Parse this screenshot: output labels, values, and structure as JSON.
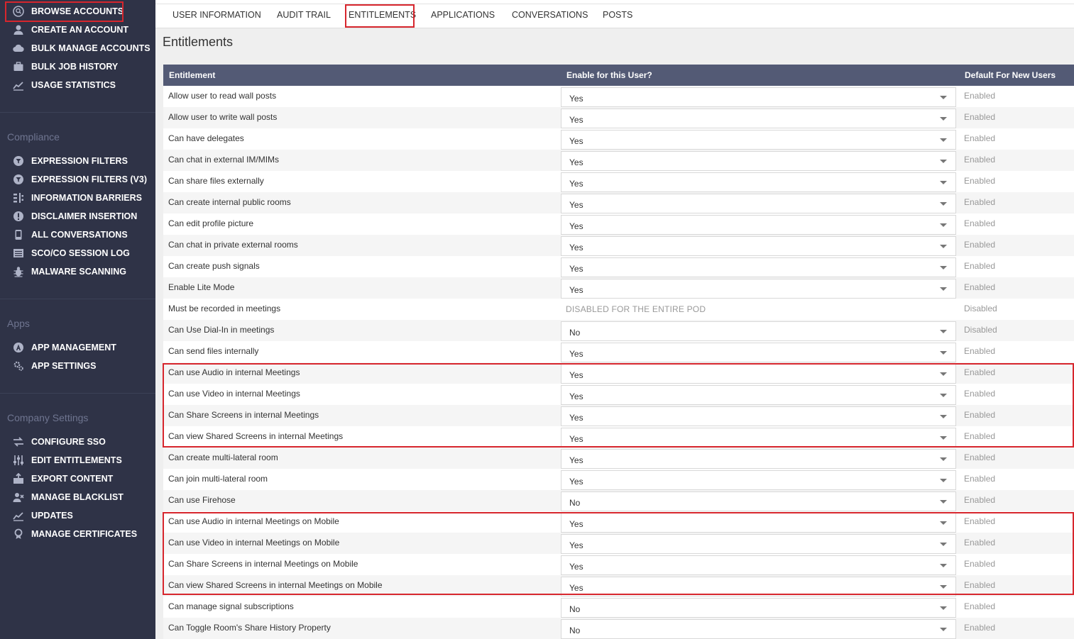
{
  "sidebar": {
    "top_items": [
      {
        "label": "BROWSE ACCOUNTS",
        "icon": "search-user-icon"
      },
      {
        "label": "CREATE AN ACCOUNT",
        "icon": "user-icon"
      },
      {
        "label": "BULK MANAGE ACCOUNTS",
        "icon": "cloud-icon"
      },
      {
        "label": "BULK JOB HISTORY",
        "icon": "briefcase-icon"
      },
      {
        "label": "USAGE STATISTICS",
        "icon": "chart-icon"
      }
    ],
    "compliance_title": "Compliance",
    "compliance_items": [
      {
        "label": "EXPRESSION FILTERS",
        "icon": "filter-icon"
      },
      {
        "label": "EXPRESSION FILTERS (V3)",
        "icon": "filter-icon"
      },
      {
        "label": "INFORMATION BARRIERS",
        "icon": "barrier-icon"
      },
      {
        "label": "DISCLAIMER INSERTION",
        "icon": "alert-icon"
      },
      {
        "label": "ALL CONVERSATIONS",
        "icon": "phone-icon"
      },
      {
        "label": "SCO/CO SESSION LOG",
        "icon": "log-icon"
      },
      {
        "label": "MALWARE SCANNING",
        "icon": "bug-icon"
      }
    ],
    "apps_title": "Apps",
    "apps_items": [
      {
        "label": "APP MANAGEMENT",
        "icon": "app-icon"
      },
      {
        "label": "APP SETTINGS",
        "icon": "gear-icon"
      }
    ],
    "company_title": "Company Settings",
    "company_items": [
      {
        "label": "CONFIGURE SSO",
        "icon": "swap-icon"
      },
      {
        "label": "EDIT ENTITLEMENTS",
        "icon": "sliders-icon"
      },
      {
        "label": "EXPORT CONTENT",
        "icon": "export-icon"
      },
      {
        "label": "MANAGE BLACKLIST",
        "icon": "person-block-icon"
      },
      {
        "label": "UPDATES",
        "icon": "chart-icon"
      },
      {
        "label": "MANAGE CERTIFICATES",
        "icon": "certificate-icon"
      }
    ]
  },
  "tabs": [
    {
      "label": "USER INFORMATION"
    },
    {
      "label": "AUDIT TRAIL"
    },
    {
      "label": "ENTITLEMENTS"
    },
    {
      "label": "APPLICATIONS"
    },
    {
      "label": "CONVERSATIONS"
    },
    {
      "label": "POSTS"
    }
  ],
  "page_title": "Entitlements",
  "table": {
    "headers": [
      "Entitlement",
      "Enable for this User?",
      "Default For New Users"
    ],
    "rows": [
      {
        "name": "Allow user to read wall posts",
        "value": "Yes",
        "default": "Enabled"
      },
      {
        "name": "Allow user to write wall posts",
        "value": "Yes",
        "default": "Enabled"
      },
      {
        "name": "Can have delegates",
        "value": "Yes",
        "default": "Enabled"
      },
      {
        "name": "Can chat in external IM/MIMs",
        "value": "Yes",
        "default": "Enabled"
      },
      {
        "name": "Can share files externally",
        "value": "Yes",
        "default": "Enabled"
      },
      {
        "name": "Can create internal public rooms",
        "value": "Yes",
        "default": "Enabled"
      },
      {
        "name": "Can edit profile picture",
        "value": "Yes",
        "default": "Enabled"
      },
      {
        "name": "Can chat in private external rooms",
        "value": "Yes",
        "default": "Enabled"
      },
      {
        "name": "Can create push signals",
        "value": "Yes",
        "default": "Enabled"
      },
      {
        "name": "Enable Lite Mode",
        "value": "Yes",
        "default": "Enabled"
      },
      {
        "name": "Must be recorded in meetings",
        "value": "",
        "pod_text": "DISABLED FOR THE ENTIRE POD",
        "default": "Disabled"
      },
      {
        "name": "Can Use Dial-In in meetings",
        "value": "No",
        "default": "Disabled"
      },
      {
        "name": "Can send files internally",
        "value": "Yes",
        "default": "Enabled"
      },
      {
        "name": "Can use Audio in internal Meetings",
        "value": "Yes",
        "default": "Enabled"
      },
      {
        "name": "Can use Video in internal Meetings",
        "value": "Yes",
        "default": "Enabled"
      },
      {
        "name": "Can Share Screens in internal Meetings",
        "value": "Yes",
        "default": "Enabled"
      },
      {
        "name": "Can view Shared Screens in internal Meetings",
        "value": "Yes",
        "default": "Enabled"
      },
      {
        "name": "Can create multi-lateral room",
        "value": "Yes",
        "default": "Enabled"
      },
      {
        "name": "Can join multi-lateral room",
        "value": "Yes",
        "default": "Enabled"
      },
      {
        "name": "Can use Firehose",
        "value": "No",
        "default": "Enabled"
      },
      {
        "name": "Can use Audio in internal Meetings on Mobile",
        "value": "Yes",
        "default": "Enabled"
      },
      {
        "name": "Can use Video in internal Meetings on Mobile",
        "value": "Yes",
        "default": "Enabled"
      },
      {
        "name": "Can Share Screens in internal Meetings on Mobile",
        "value": "Yes",
        "default": "Enabled"
      },
      {
        "name": "Can view Shared Screens in internal Meetings on Mobile",
        "value": "Yes",
        "default": "Enabled"
      },
      {
        "name": "Can manage signal subscriptions",
        "value": "No",
        "default": "Enabled"
      },
      {
        "name": "Can Toggle Room's Share History Property",
        "value": "No",
        "default": "Enabled"
      }
    ]
  },
  "colors": {
    "sidebar_bg": "#2f3347",
    "table_header_bg": "#535a75",
    "highlight": "#d7262d"
  }
}
